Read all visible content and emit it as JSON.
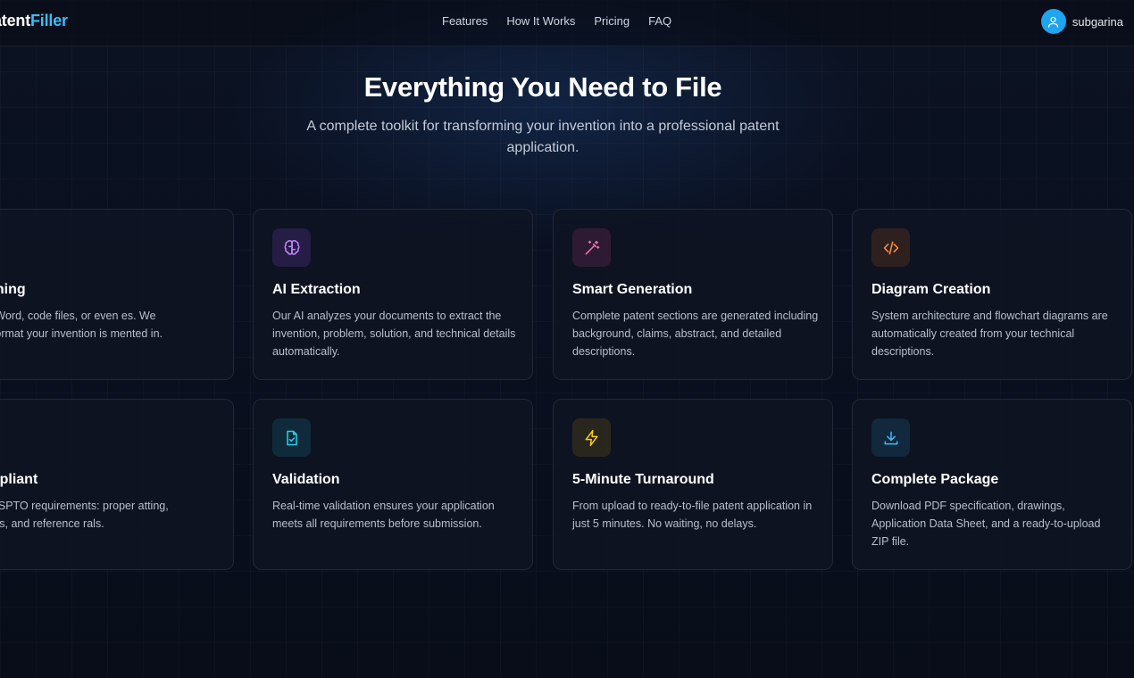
{
  "brand": {
    "part1": "atent",
    "part2": "Filler"
  },
  "nav": [
    {
      "label": "Features"
    },
    {
      "label": "How It Works"
    },
    {
      "label": "Pricing"
    },
    {
      "label": "FAQ"
    }
  ],
  "user": {
    "name": "subgarina",
    "icon": "user-icon"
  },
  "hero": {
    "title": "Everything You Need to File",
    "subtitle": "A complete toolkit for transforming your invention into a professional patent application."
  },
  "cards": [
    {
      "title": "oad Anything",
      "desc": "down, PDF, Word, code files, or even es. We accept any format your invention is mented in.",
      "icon": "upload-icon",
      "color": "#3b82f6"
    },
    {
      "title": "AI Extraction",
      "desc": "Our AI analyzes your documents to extract the invention, problem, solution, and technical details automatically.",
      "icon": "brain-icon",
      "color": "#c084fc"
    },
    {
      "title": "Smart Generation",
      "desc": "Complete patent sections are generated including background, claims, abstract, and detailed descriptions.",
      "icon": "magic-wand-icon",
      "color": "#f472b6"
    },
    {
      "title": "Diagram Creation",
      "desc": "System architecture and flowchart diagrams are automatically created from your technical descriptions.",
      "icon": "code-icon",
      "color": "#fb923c"
    },
    {
      "title": "PTO Compliant",
      "desc": "tputs meet USPTO requirements: proper atting, margins, fonts, and reference rals.",
      "icon": "shield-check-icon",
      "color": "#22c55e"
    },
    {
      "title": "Validation",
      "desc": "Real-time validation ensures your application meets all requirements before submission.",
      "icon": "file-check-icon",
      "color": "#22d3ee"
    },
    {
      "title": "5-Minute Turnaround",
      "desc": "From upload to ready-to-file patent application in just 5 minutes. No waiting, no delays.",
      "icon": "lightning-icon",
      "color": "#facc15"
    },
    {
      "title": "Complete Package",
      "desc": "Download PDF specification, drawings, Application Data Sheet, and a ready-to-upload ZIP file.",
      "icon": "download-icon",
      "color": "#38bdf8"
    }
  ]
}
